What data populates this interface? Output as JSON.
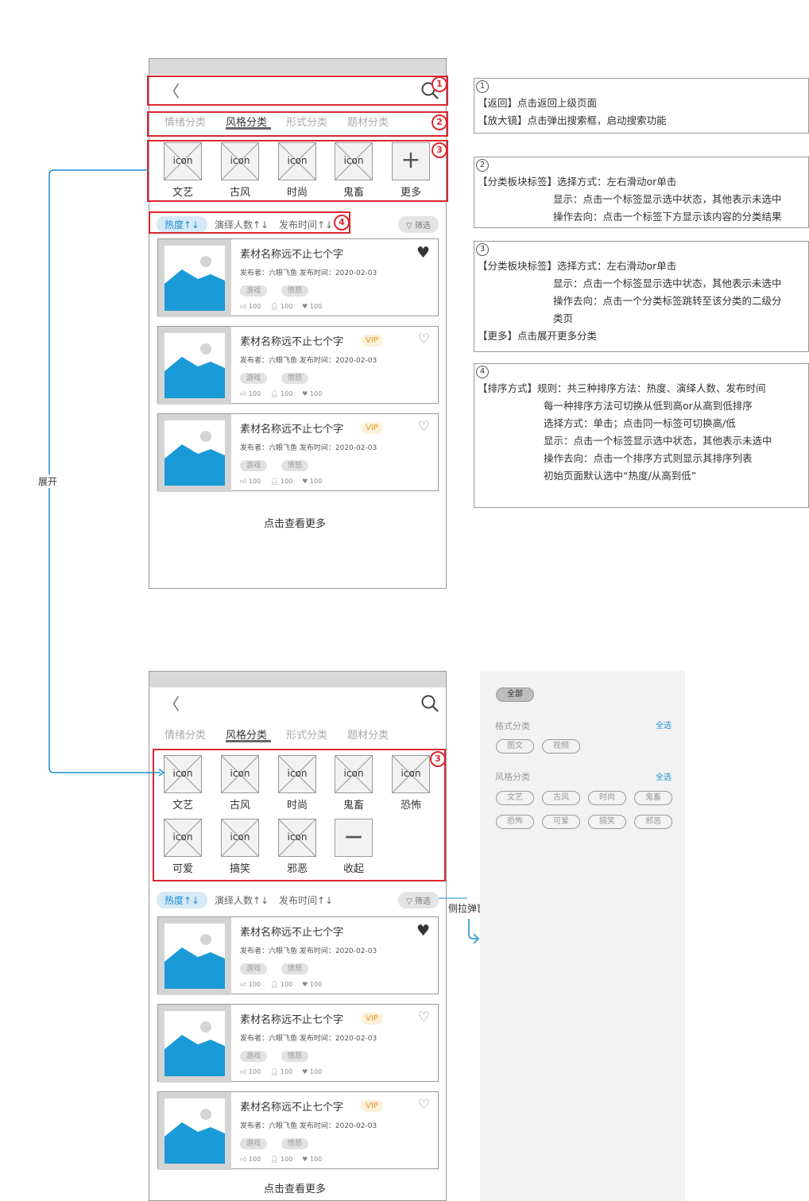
{
  "colors": {
    "accent": "#1a8fd0",
    "annotation": "#d9272e",
    "image_fill": "#1a9ad6"
  },
  "top_phone": {
    "tabs": [
      "情绪分类",
      "风格分类",
      "形式分类",
      "题材分类"
    ],
    "icon_text": "icon",
    "categories": [
      "文艺",
      "古风",
      "时尚",
      "鬼畜",
      "更多"
    ],
    "sorts": [
      "热度↑↓",
      "演绎人数↑↓",
      "发布时间↑↓"
    ],
    "filter": "筛选",
    "cards": [
      {
        "title": "素材名称远不止七个字",
        "vip": "",
        "meta": "发布者：六眼飞鱼    发布时间：2020-02-03",
        "tags": [
          "游戏",
          "愤怒"
        ],
        "likes": "100",
        "users": "100",
        "hearts": "100",
        "fav": "filled"
      },
      {
        "title": "素材名称远不止七个字",
        "vip": "VIP",
        "meta": "发布者：六眼飞鱼    发布时间：2020-02-03",
        "tags": [
          "游戏",
          "愤怒"
        ],
        "likes": "100",
        "users": "100",
        "hearts": "100",
        "fav": "outline"
      },
      {
        "title": "素材名称远不止七个字",
        "vip": "VIP",
        "meta": "发布者：六眼飞鱼    发布时间：2020-02-03",
        "tags": [
          "游戏",
          "愤怒"
        ],
        "likes": "100",
        "users": "100",
        "hearts": "100",
        "fav": "outline"
      }
    ],
    "more": "点击查看更多"
  },
  "bottom_phone": {
    "tabs": [
      "情绪分类",
      "风格分类",
      "形式分类",
      "题材分类"
    ],
    "icon_text": "icon",
    "categories": [
      "文艺",
      "古风",
      "时尚",
      "鬼畜",
      "恐怖",
      "可爱",
      "搞笑",
      "邪恶",
      "收起"
    ],
    "sorts": [
      "热度↑↓",
      "演绎人数↑↓",
      "发布时间↑↓"
    ],
    "filter": "筛选",
    "cards": [
      {
        "title": "素材名称远不止七个字",
        "vip": "",
        "meta": "发布者：六眼飞鱼    发布时间：2020-02-03",
        "tags": [
          "游戏",
          "愤怒"
        ],
        "likes": "100",
        "users": "100",
        "hearts": "100",
        "fav": "filled"
      },
      {
        "title": "素材名称远不止七个字",
        "vip": "VIP",
        "meta": "发布者：六眼飞鱼    发布时间：2020-02-03",
        "tags": [
          "游戏",
          "愤怒"
        ],
        "likes": "100",
        "users": "100",
        "hearts": "100",
        "fav": "outline"
      },
      {
        "title": "素材名称远不止七个字",
        "vip": "VIP",
        "meta": "发布者：六眼飞鱼    发布时间：2020-02-03",
        "tags": [
          "游戏",
          "愤怒"
        ],
        "likes": "100",
        "users": "100",
        "hearts": "100",
        "fav": "outline"
      }
    ],
    "more": "点击查看更多"
  },
  "drawer": {
    "all": "全部",
    "format_title": "格式分类",
    "format_all": "全选",
    "formats": [
      "图文",
      "视频"
    ],
    "style_title": "风格分类",
    "style_all": "全选",
    "styles": [
      "文艺",
      "古风",
      "时尚",
      "鬼畜",
      "恐怖",
      "可爱",
      "搞笑",
      "邪恶"
    ]
  },
  "annotations": {
    "expand": "展开",
    "side_popup": "侧拉弹窗",
    "markers": [
      "1",
      "2",
      "3",
      "4"
    ]
  },
  "notes": [
    {
      "num": "1",
      "lines": [
        "【返回】点击返回上级页面",
        "【放大镜】点击弹出搜索框，启动搜索功能"
      ]
    },
    {
      "num": "2",
      "lines": [
        "【分类板块标签】选择方式：左右滑动or单击",
        "显示：点击一个标签显示选中状态，其他表示未选中",
        "操作去向：点击一个标签下方显示该内容的分类结果"
      ]
    },
    {
      "num": "3",
      "lines": [
        "【分类板块标签】选择方式：左右滑动or单击",
        "显示：点击一个标签显示选中状态，其他表示未选中",
        "操作去向：点击一个分类标签跳转至该分类的二级分",
        "类页",
        "【更多】点击展开更多分类"
      ]
    },
    {
      "num": "4",
      "lines": [
        "【排序方式】规则：共三种排序方法：热度、演绎人数、发布时间",
        "每一种排序方法可切换从低到高or从高到低排序",
        "选择方式：单击；点击同一标签可切换高/低",
        "显示：点击一个标签显示选中状态，其他表示未选中",
        "操作去向：点击一个排序方式则显示其排序列表",
        "初始页面默认选中“热度/从高到低”"
      ]
    }
  ]
}
